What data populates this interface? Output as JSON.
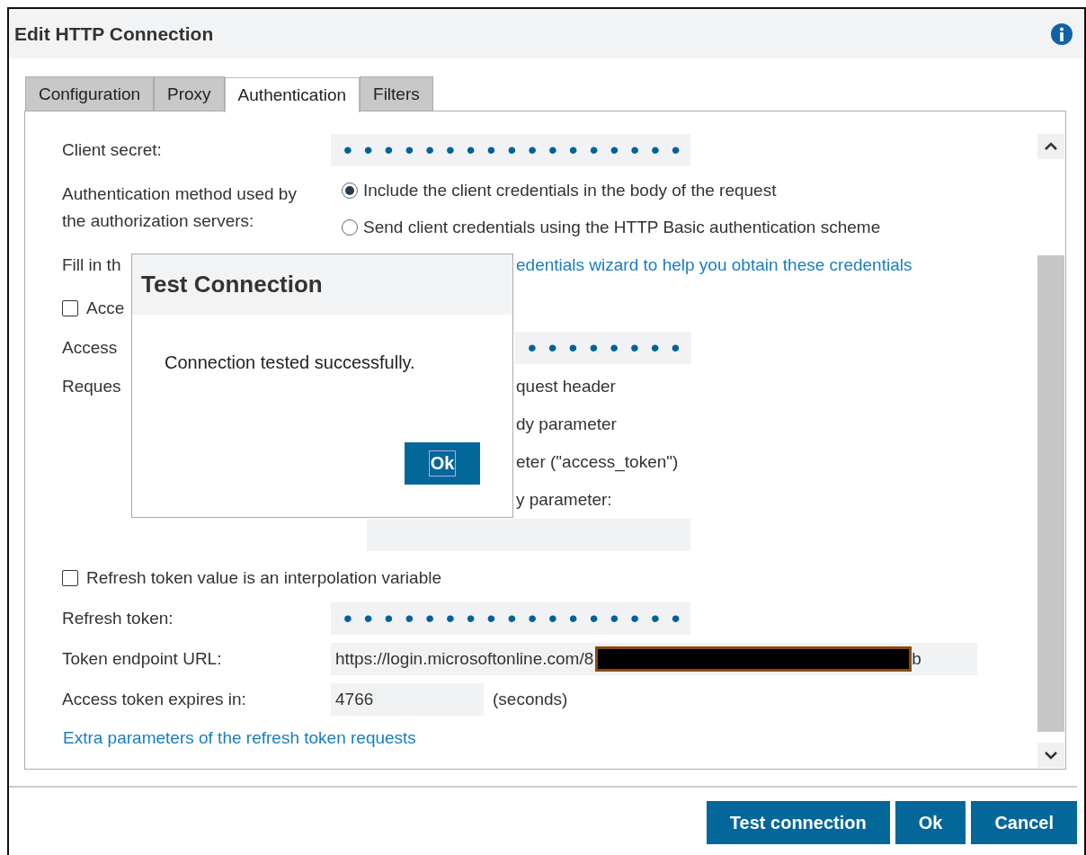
{
  "window": {
    "title": "Edit HTTP Connection"
  },
  "tabs": [
    {
      "label": "Configuration",
      "selected": false
    },
    {
      "label": "Proxy",
      "selected": false
    },
    {
      "label": "Authentication",
      "selected": true
    },
    {
      "label": "Filters",
      "selected": false
    }
  ],
  "form": {
    "client_secret": {
      "label": "Client secret:",
      "value": "•••••••••••••••••"
    },
    "auth_method": {
      "label": "Authentication method used by the authorization servers:",
      "options": [
        {
          "label": "Include the client credentials in the body of the request",
          "selected": true
        },
        {
          "label": "Send client credentials using the HTTP Basic authentication scheme",
          "selected": false
        }
      ]
    },
    "fill_in": {
      "text": "Fill in th",
      "link": "edentials wizard to help you obtain these credentials"
    },
    "access_token_variable": {
      "label": "Acce",
      "checked": false
    },
    "access_token": {
      "label": "Access",
      "value": "••••••••"
    },
    "request": {
      "label": "Reques",
      "options": [
        "quest header",
        "dy parameter",
        "eter (\"access_token\")",
        "y parameter:"
      ]
    },
    "refresh_variable": {
      "label": "Refresh token value is an interpolation variable",
      "checked": false
    },
    "refresh_token": {
      "label": "Refresh token:",
      "value": "•••••••••••••••••"
    },
    "token_endpoint": {
      "label": "Token endpoint URL:",
      "value": "https://login.microsoftonline.com/8",
      "value_end": "b"
    },
    "expires": {
      "label": "Access token expires in:",
      "value": "4766",
      "unit": "(seconds)"
    },
    "extra_link": "Extra parameters of the refresh token requests"
  },
  "modal": {
    "title": "Test Connection",
    "message": "Connection tested successfully.",
    "button": "Ok"
  },
  "buttons": [
    "Test connection",
    "Ok",
    "Cancel"
  ]
}
